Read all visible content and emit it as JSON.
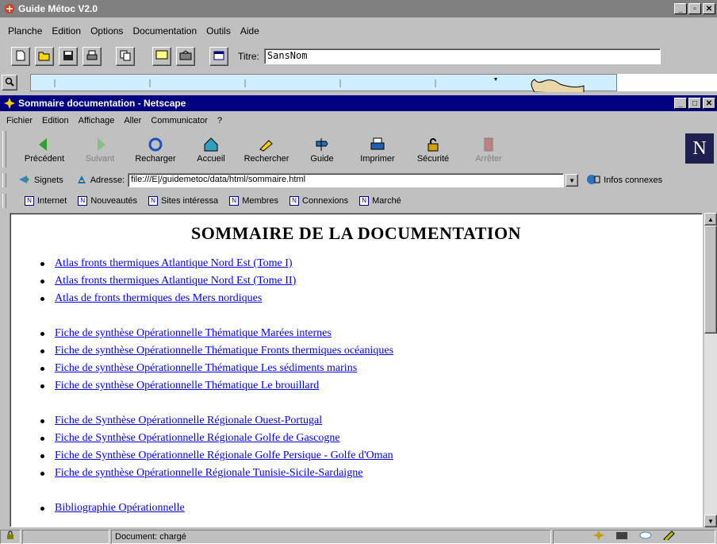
{
  "app": {
    "title": "Guide Métoc V2.0",
    "menu": [
      "Planche",
      "Edition",
      "Options",
      "Documentation",
      "Outils",
      "Aide"
    ],
    "title_label": "Titre:",
    "title_value": "SansNom"
  },
  "browser": {
    "title": "Sommaire documentation - Netscape",
    "menu": [
      "Fichier",
      "Edition",
      "Affichage",
      "Aller",
      "Communicator",
      "?"
    ],
    "nav": [
      {
        "label": "Précédent",
        "icon": "back-icon",
        "enabled": true
      },
      {
        "label": "Suivant",
        "icon": "forward-icon",
        "enabled": false
      },
      {
        "label": "Recharger",
        "icon": "reload-icon",
        "enabled": true
      },
      {
        "label": "Accueil",
        "icon": "home-icon",
        "enabled": true
      },
      {
        "label": "Rechercher",
        "icon": "search-icon",
        "enabled": true
      },
      {
        "label": "Guide",
        "icon": "guide-icon",
        "enabled": true
      },
      {
        "label": "Imprimer",
        "icon": "print-icon",
        "enabled": true
      },
      {
        "label": "Sécurité",
        "icon": "lock-icon",
        "enabled": true
      },
      {
        "label": "Arrêter",
        "icon": "stop-icon",
        "enabled": false
      }
    ],
    "signets_label": "Signets",
    "address_label": "Adresse:",
    "address_value": "file:///E|/guidemetoc/data/html/sommaire.html",
    "related_label": "Infos connexes",
    "bookmarks": [
      "Internet",
      "Nouveautés",
      "Sites intéressa",
      "Membres",
      "Connexions",
      "Marché"
    ],
    "status": "Document: chargé"
  },
  "document": {
    "heading": "SOMMAIRE DE LA DOCUMENTATION",
    "groups": [
      [
        "Atlas fronts thermiques Atlantique Nord Est (Tome I)",
        "Atlas fronts thermiques Atlantique Nord Est (Tome II)",
        "Atlas de fronts thermiques des Mers nordiques"
      ],
      [
        "Fiche de synthèse Opérationnelle Thématique Marées internes",
        "Fiche de synthèse Opérationnelle Thématique Fronts thermiques océaniques",
        "Fiche de synthèse Opérationnelle Thématique Les sédiments marins",
        "Fiche de synthèse Opérationnelle Thématique Le brouillard"
      ],
      [
        "Fiche de Synthèse Opérationnelle Régionale Ouest-Portugal",
        "Fiche de Synthèse Opérationnelle Régionale Golfe de Gascogne",
        "Fiche de Synthèse Opérationnelle Régionale Golfe Persique - Golfe d'Oman",
        "Fiche de synthèse Opérationnelle Régionale Tunisie-Sicile-Sardaigne"
      ],
      [
        "Bibliographie Opérationnelle"
      ]
    ]
  }
}
